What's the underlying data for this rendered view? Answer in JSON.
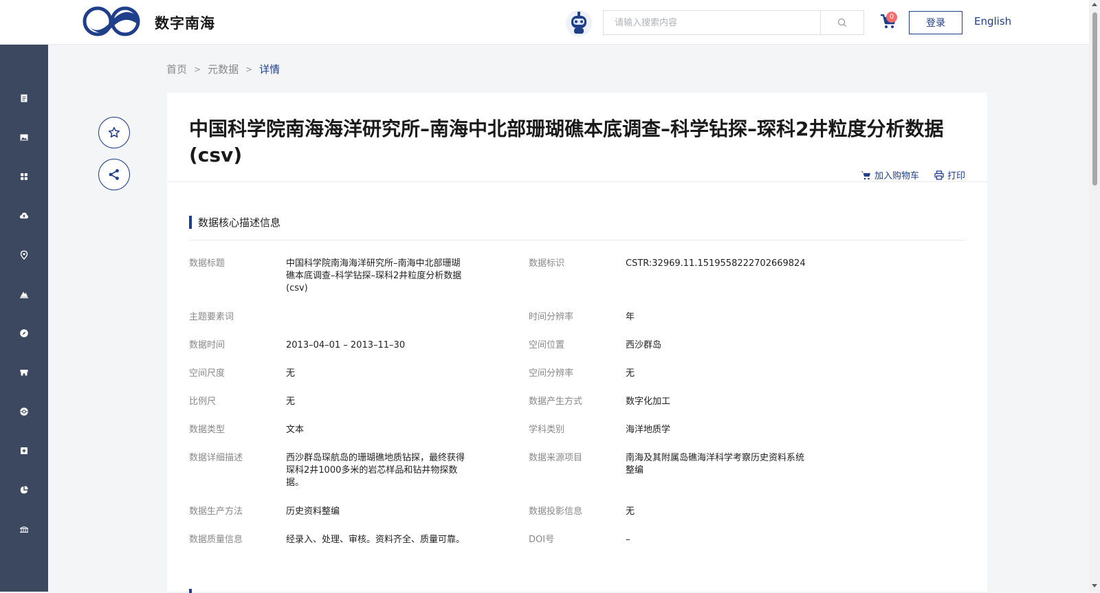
{
  "header": {
    "site_name": "数字南海",
    "search_placeholder": "请输入搜索内容",
    "cart_count": "0",
    "login_label": "登录",
    "language_label": "English"
  },
  "breadcrumb": {
    "home": "首页",
    "metadata": "元数据",
    "current": "详情"
  },
  "detail": {
    "title": "中国科学院南海海洋研究所–南海中北部珊瑚礁本底调查–科学钻探–琛科2井粒度分析数据(csv)",
    "add_to_cart": "加入购物车",
    "print": "打印",
    "section_title": "数据核心描述信息"
  },
  "fields_left": [
    {
      "label": "数据标题",
      "lines": [
        "中国科学院南海海洋研究所–南海中北部珊瑚",
        "礁本底调查–科学钻探–琛科2井粒度分析数据",
        "(csv)"
      ]
    },
    {
      "label": "主题要素词",
      "lines": [
        ""
      ]
    },
    {
      "label": "数据时间",
      "lines": [
        "2013–04–01 – 2013–11–30"
      ]
    },
    {
      "label": "空间尺度",
      "lines": [
        "无"
      ]
    },
    {
      "label": "比例尺",
      "lines": [
        "无"
      ]
    },
    {
      "label": "数据类型",
      "lines": [
        "文本"
      ]
    },
    {
      "label": "数据详细描述",
      "lines": [
        "西沙群岛琛航岛的珊瑚礁地质钻探，最终获得",
        "琛科2井1000多米的岩芯样品和钻井物探数",
        "据。"
      ]
    },
    {
      "label": "数据生产方法",
      "lines": [
        "历史资料整编"
      ]
    },
    {
      "label": "数据质量信息",
      "lines": [
        "经录入、处理、审核。资料齐全、质量可靠。"
      ]
    }
  ],
  "fields_right": [
    {
      "label": "数据标识",
      "lines": [
        "CSTR:32969.11.1519558222702669824"
      ]
    },
    {
      "label": "时间分辨率",
      "lines": [
        "年"
      ]
    },
    {
      "label": "空间位置",
      "lines": [
        "西沙群岛"
      ]
    },
    {
      "label": "空间分辨率",
      "lines": [
        "无"
      ]
    },
    {
      "label": "数据产生方式",
      "lines": [
        "数字化加工"
      ]
    },
    {
      "label": "学科类别",
      "lines": [
        "海洋地质学"
      ]
    },
    {
      "label": "数据来源项目",
      "lines": [
        "南海及其附属岛礁海洋科学考察历史资料系统",
        "整编"
      ]
    },
    {
      "label": "数据投影信息",
      "lines": [
        "无"
      ]
    },
    {
      "label": "DOI号",
      "lines": [
        "–"
      ]
    }
  ],
  "sidebar_icons": [
    "document-icon",
    "image-icon",
    "grid-icon",
    "cloud-upload-icon",
    "location-pin-icon",
    "mountain-icon",
    "compass-icon",
    "store-icon",
    "globe-icon",
    "plus-box-icon",
    "pie-chart-icon",
    "bridge-icon"
  ],
  "colors": {
    "primary": "#1f3f8a",
    "sidebar": "#3b4860",
    "badge": "#f56c6c"
  }
}
